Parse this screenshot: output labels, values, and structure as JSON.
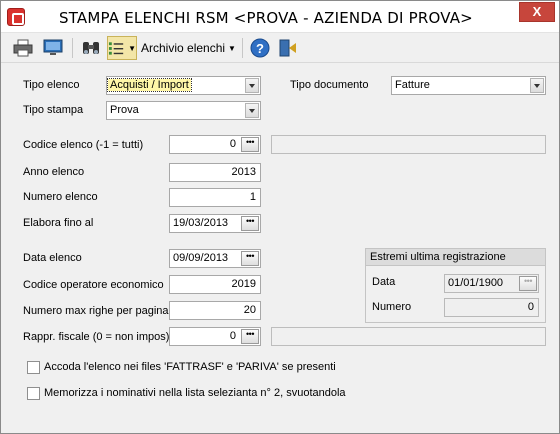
{
  "window": {
    "title": "STAMPA ELENCHI RSM <PROVA - AZIENDA DI PROVA>",
    "close_glyph": "X"
  },
  "toolbar": {
    "print_icon": "printer-icon",
    "preview_icon": "monitor-icon",
    "find_icon": "binoculars-icon",
    "list_icon": "list-icon",
    "archive_label": "Archivio elenchi",
    "help_icon": "help-icon",
    "exit_icon": "exit-icon"
  },
  "form": {
    "tipo_elenco": {
      "label": "Tipo elenco",
      "value": "Acquisti / Import"
    },
    "tipo_documento": {
      "label": "Tipo documento",
      "value": "Fatture"
    },
    "tipo_stampa": {
      "label": "Tipo stampa",
      "value": "Prova"
    },
    "codice_elenco": {
      "label": "Codice elenco (-1 = tutti)",
      "value": "0",
      "description": ""
    },
    "anno_elenco": {
      "label": "Anno elenco",
      "value": "2013"
    },
    "numero_elenco": {
      "label": "Numero elenco",
      "value": "1"
    },
    "elabora_fino": {
      "label": "Elabora fino al",
      "value": "19/03/2013"
    },
    "data_elenco": {
      "label": "Data elenco",
      "value": "09/09/2013"
    },
    "codice_operatore": {
      "label": "Codice operatore economico",
      "value": "2019"
    },
    "numero_max_righe": {
      "label": "Numero max righe per pagina",
      "value": "20"
    },
    "rappr_fiscale": {
      "label": "Rappr. fiscale (0 = non impos)",
      "value": "0",
      "description": ""
    }
  },
  "estremi": {
    "title": "Estremi ultima registrazione",
    "data_label": "Data",
    "data_value": "01/01/1900",
    "numero_label": "Numero",
    "numero_value": "0"
  },
  "options": {
    "accoda": {
      "label": "Accoda l'elenco nei files 'FATTRASF' e 'PARIVA' se presenti",
      "checked": false
    },
    "memorizza": {
      "label": "Memorizza i nominativi nella lista selezianta n° 2, svuotandola",
      "checked": false
    }
  },
  "colors": {
    "accent_red": "#d9322e",
    "focus_yellow": "#fff6a8",
    "window_bg": "#f0f0f0"
  }
}
